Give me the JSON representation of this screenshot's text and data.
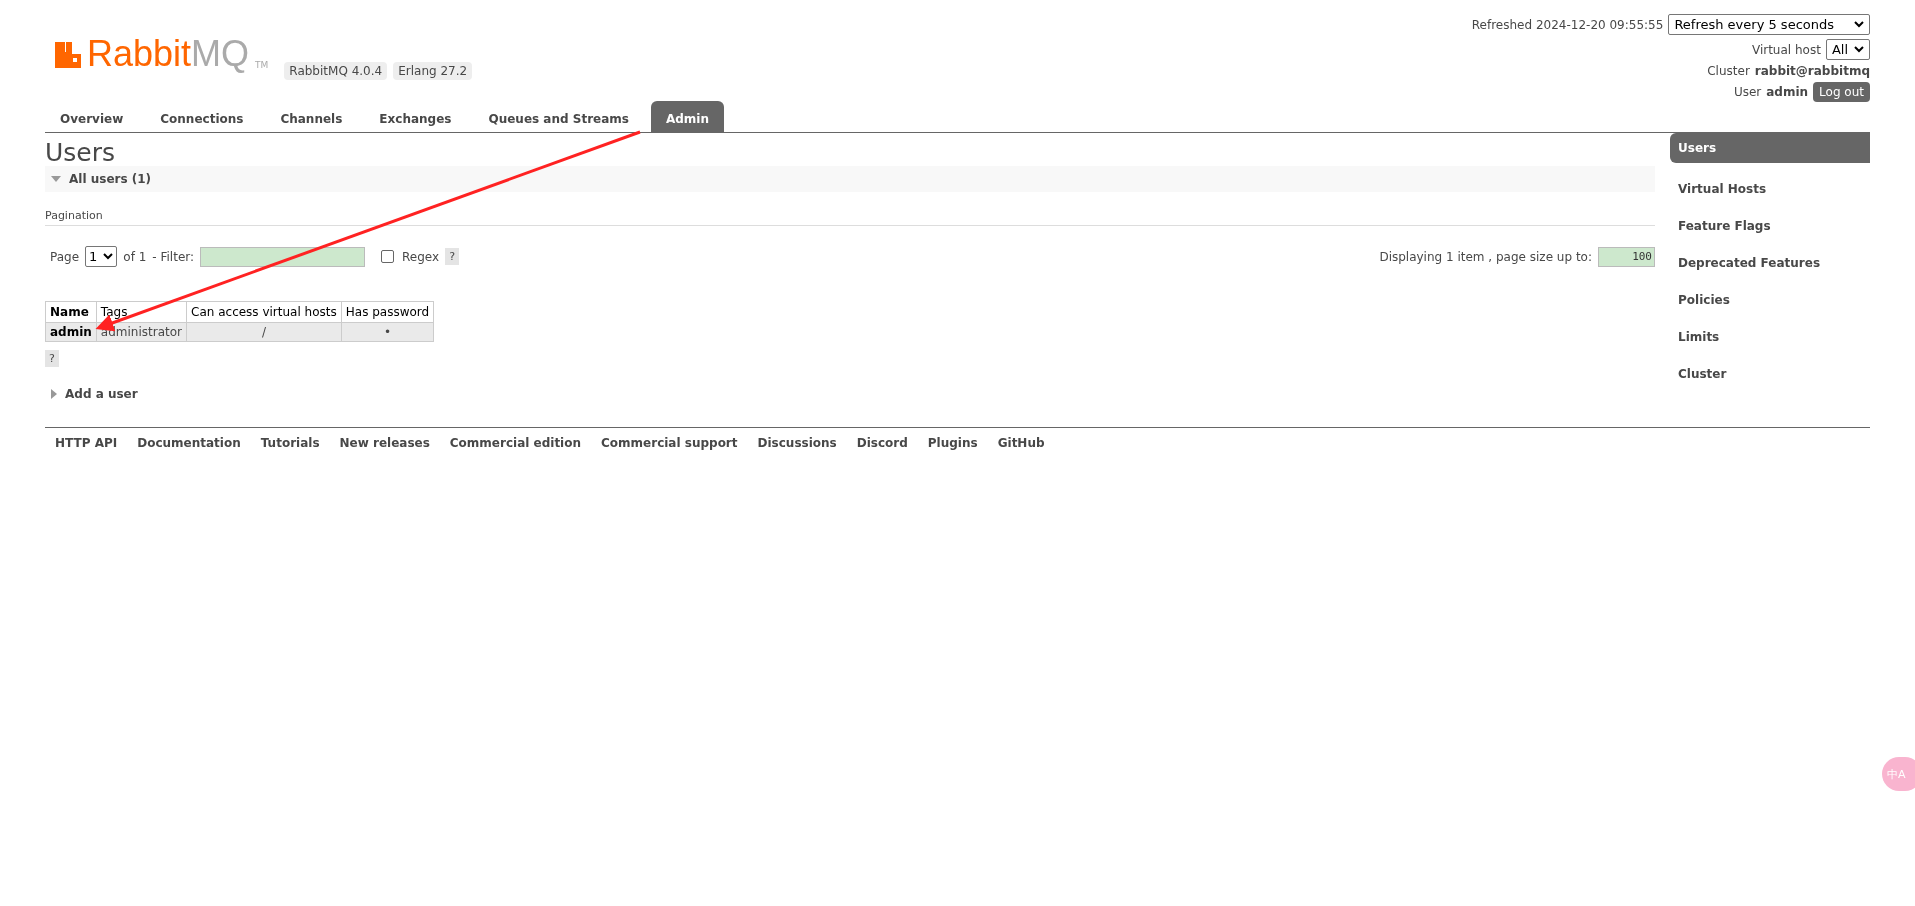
{
  "logo": {
    "primary": "Rabbit",
    "secondary": "MQ",
    "trademark": "TM"
  },
  "versions": [
    "RabbitMQ 4.0.4",
    "Erlang 27.2"
  ],
  "header": {
    "refreshed": "Refreshed 2024-12-20 09:55:55",
    "refresh_select": "Refresh every 5 seconds",
    "vhost_label": "Virtual host",
    "vhost_select": "All",
    "cluster_label": "Cluster",
    "cluster_name": "rabbit@rabbitmq",
    "user_label": "User",
    "user_name": "admin",
    "logout": "Log out"
  },
  "tabs": [
    {
      "label": "Overview",
      "selected": false
    },
    {
      "label": "Connections",
      "selected": false
    },
    {
      "label": "Channels",
      "selected": false
    },
    {
      "label": "Exchanges",
      "selected": false
    },
    {
      "label": "Queues and Streams",
      "selected": false
    },
    {
      "label": "Admin",
      "selected": true
    }
  ],
  "page_title": "Users",
  "all_users": {
    "title": "All users (1)",
    "expanded": true
  },
  "pagination": {
    "heading": "Pagination",
    "page_label": "Page",
    "page_select": "1",
    "of": "of 1",
    "filter_label": "- Filter:",
    "regex_checked": false,
    "regex_label": "Regex",
    "help": "?",
    "displaying": "Displaying 1 item , page size up to:",
    "page_size": "100"
  },
  "table": {
    "columns": [
      "Name",
      "Tags",
      "Can access virtual hosts",
      "Has password"
    ],
    "rows": [
      {
        "cells": [
          "admin",
          "administrator",
          "/",
          "•"
        ]
      }
    ]
  },
  "table_help": "?",
  "add_user": {
    "title": "Add a user",
    "expanded": false
  },
  "sidebar": {
    "items": [
      {
        "label": "Users",
        "selected": true
      },
      {
        "label": "Virtual Hosts",
        "selected": false
      },
      {
        "label": "Feature Flags",
        "selected": false
      },
      {
        "label": "Deprecated Features",
        "selected": false
      },
      {
        "label": "Policies",
        "selected": false
      },
      {
        "label": "Limits",
        "selected": false
      },
      {
        "label": "Cluster",
        "selected": false
      }
    ]
  },
  "footer_links": [
    "HTTP API",
    "Documentation",
    "Tutorials",
    "New releases",
    "Commercial edition",
    "Commercial support",
    "Discussions",
    "Discord",
    "Plugins",
    "GitHub"
  ],
  "translate_button": {
    "label": "中A"
  }
}
